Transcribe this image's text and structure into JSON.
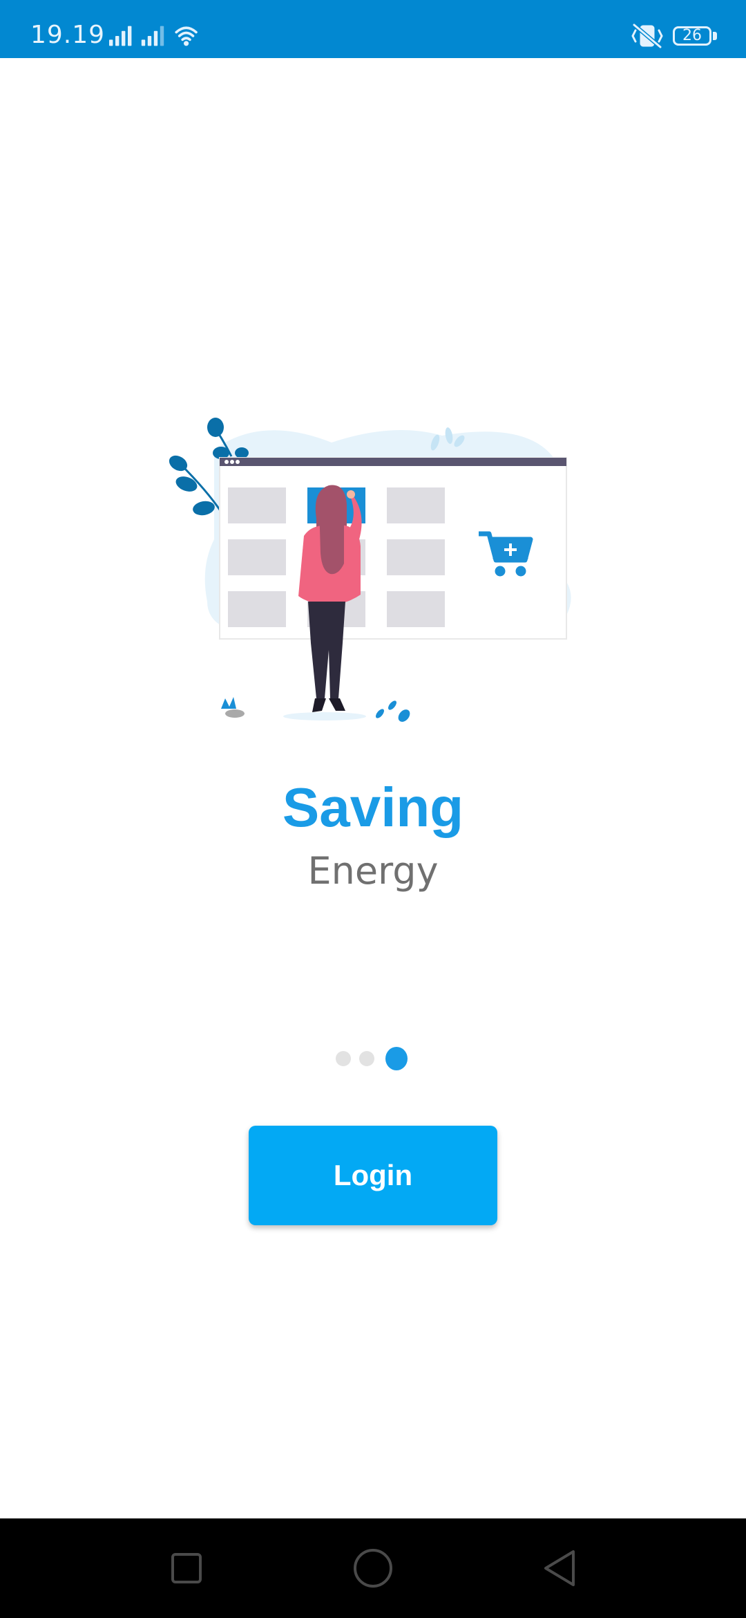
{
  "status_bar": {
    "time": "19.19",
    "battery_level": "26"
  },
  "onboarding": {
    "title": "Saving",
    "subtitle": "Energy",
    "page_count": 3,
    "current_page": 3
  },
  "actions": {
    "login_label": "Login"
  },
  "colors": {
    "status_bar": "#0288d1",
    "accent": "#1a9be6",
    "button": "#03a9f4",
    "subtitle": "#707070",
    "inactive_dot": "#e2e2e2"
  },
  "icons": {
    "signal_1": "signal-icon",
    "signal_2": "signal-icon",
    "wifi": "wifi-icon",
    "mute": "vibrate-off-icon",
    "battery": "battery-icon",
    "nav_recent": "square-icon",
    "nav_home": "circle-icon",
    "nav_back": "triangle-back-icon"
  }
}
